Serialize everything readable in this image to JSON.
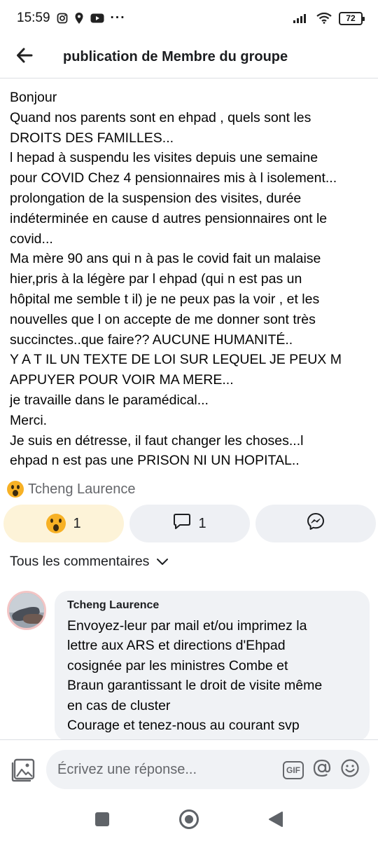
{
  "status_bar": {
    "time": "15:59",
    "more": "···",
    "battery": "72"
  },
  "header": {
    "title": "publication de Membre du groupe",
    "back_icon": "arrow-left-icon"
  },
  "post": {
    "lines": [
      "Bonjour",
      "Quand nos parents  sont en ehpad , quels sont les",
      "DROITS DES FAMILLES...",
      "l hepad à suspendu les visites depuis une semaine",
      "pour COVID Chez 4 pensionnaires mis à l isolement...",
      "prolongation  de la suspension  des visites, durée",
      "indéterminée  en cause d autres pensionnaires ont le",
      "covid...",
      "Ma mère 90 ans qui n à pas le covid  fait un malaise",
      "hier,pris à la légère par l ehpad (qui n est pas un",
      "hôpital me semble  t il) je ne peux pas la voir , et les",
      "nouvelles  que l on accepte de me donner sont très",
      "succinctes..que faire?? AUCUNE HUMANITÉ..",
      "Y A T IL UN TEXTE DE LOI SUR LEQUEL JE PEUX M",
      "APPUYER POUR VOIR MA MERE...",
      "je travaille  dans le paramédical...",
      "Merci.",
      "Je suis en détresse,  il faut changer les choses...l",
      "ehpad n est pas une PRISON NI UN HOPITAL.."
    ]
  },
  "reactions": {
    "reactor_name": "Tcheng Laurence",
    "wow_count": "1",
    "comment_count": "1"
  },
  "comments_filter": {
    "label": "Tous les commentaires"
  },
  "comment": {
    "author": "Tcheng Laurence",
    "lines": [
      "Envoyez-leur par mail et/ou imprimez la",
      "lettre aux ARS et directions d'Ehpad",
      "cosignée par les ministres Combe et",
      "Braun garantissant le droit de visite même",
      "en cas de cluster",
      "Courage et tenez-nous au courant svp"
    ]
  },
  "reply": {
    "placeholder": "Écrivez une réponse...",
    "gif_label": "GIF"
  },
  "colors": {
    "wow_active_bg": "#fdf3d8",
    "button_bg": "#eef0f4",
    "bubble_bg": "#f0f2f5",
    "secondary_text": "#65676b"
  }
}
